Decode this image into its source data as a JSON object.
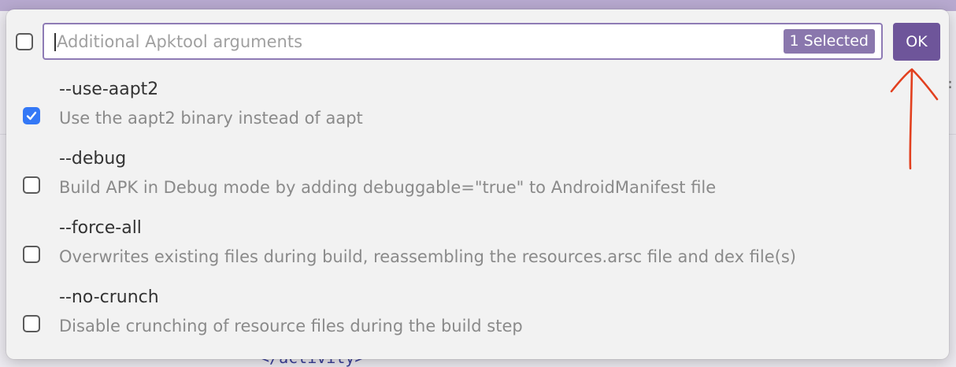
{
  "search": {
    "placeholder": "Additional Apktool arguments",
    "selected_badge": "1 Selected"
  },
  "ok_button": {
    "label": "OK"
  },
  "options": [
    {
      "flag": "--use-aapt2",
      "description": "Use the aapt2 binary instead of aapt",
      "checked": true
    },
    {
      "flag": "--debug",
      "description": "Build APK in Debug mode by adding debuggable=\"true\" to AndroidManifest file",
      "checked": false
    },
    {
      "flag": "--force-all",
      "description": "Overwrites existing files during build, reassembling the resources.arsc file and dex file(s)",
      "checked": false
    },
    {
      "flag": "--no-crunch",
      "description": "Disable crunching of resource files during the build step",
      "checked": false
    }
  ],
  "background": {
    "code_fragment": "</activity>"
  },
  "colors": {
    "accent": "#6e559a",
    "badge": "#8a77ad",
    "checkbox_checked": "#3478f6",
    "annotation_arrow": "#e2401f"
  }
}
